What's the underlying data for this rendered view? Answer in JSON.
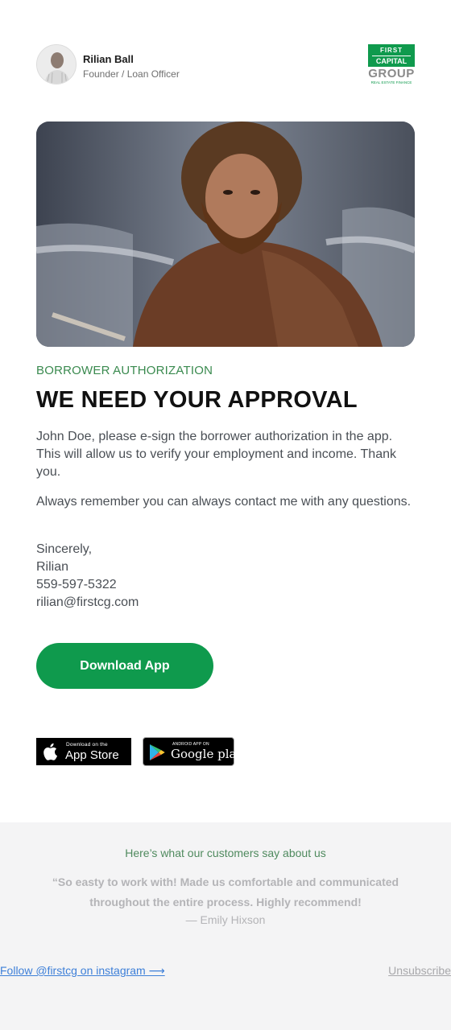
{
  "sender": {
    "name": "Rilian Ball",
    "role": "Founder / Loan Officer"
  },
  "logo": {
    "line1": "FIRST",
    "line2": "CAPITAL",
    "line3": "GROUP",
    "line4": "REAL ESTATE FINANCE"
  },
  "content": {
    "eyebrow": "BORROWER AUTHORIZATION",
    "headline": "WE NEED YOUR APPROVAL",
    "paragraph1": "John Doe, please e-sign the borrower authorization in the app. This will allow us to verify your employment and income. Thank you.",
    "paragraph2": "Always remember you can always contact me with any questions.",
    "signature": [
      "Sincerely,",
      "Rilian",
      "559-597-5322",
      "rilian@firstcg.com"
    ]
  },
  "cta": {
    "label": "Download App"
  },
  "stores": {
    "appstore_small": "Download on the",
    "appstore_big": "App Store",
    "gplay_small": "ANDROID APP ON",
    "gplay_big": "Google play"
  },
  "footer": {
    "testimonial_title": "Here’s what our customers say about us",
    "testimonial_quote": "“So easty to work with! Made us comfortable and communicated throughout the entire process. Highly recommend!",
    "testimonial_author": "— Emily Hixson",
    "follow_link": "Follow @firstcg on instagram ⟶",
    "unsubscribe_link": "Unsubscribe"
  },
  "colors": {
    "brand_green": "#0f9a4d",
    "eyebrow_green": "#3a8a4f",
    "link_blue": "#3d7fd8"
  }
}
